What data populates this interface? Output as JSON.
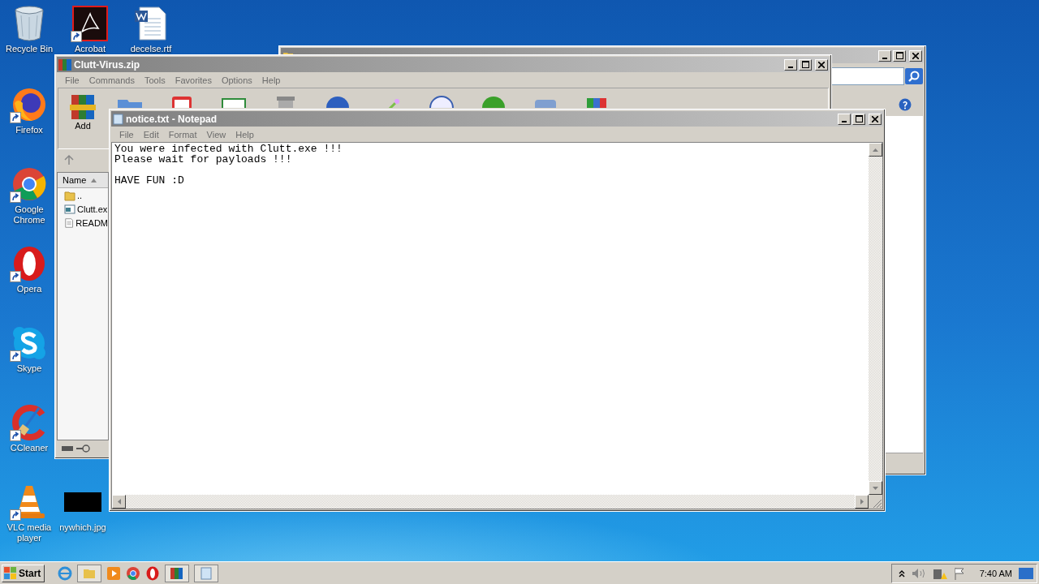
{
  "desktop_icons": [
    {
      "label": "Recycle Bin",
      "kind": "recycle",
      "shortcut": false
    },
    {
      "label": "Acrobat",
      "kind": "acrobat",
      "shortcut": true
    },
    {
      "label": "decelse.rtf",
      "kind": "word",
      "shortcut": false
    },
    {
      "label": "Firefox",
      "kind": "firefox",
      "shortcut": true
    },
    {
      "label": "Google Chrome",
      "kind": "chrome",
      "shortcut": true
    },
    {
      "label": "Opera",
      "kind": "opera",
      "shortcut": true
    },
    {
      "label": "Skype",
      "kind": "skype",
      "shortcut": true
    },
    {
      "label": "CCleaner",
      "kind": "ccleaner",
      "shortcut": true
    },
    {
      "label": "VLC media player",
      "kind": "vlc",
      "shortcut": true
    },
    {
      "label": "nywhich.jpg",
      "kind": "image",
      "shortcut": false
    }
  ],
  "archive_window": {
    "title": "Clutt-Virus.zip",
    "menu": [
      "File",
      "Commands",
      "Tools",
      "Favorites",
      "Options",
      "Help"
    ],
    "add_button": "Add",
    "column": "Name",
    "files": [
      {
        "name": "..",
        "kind": "folder"
      },
      {
        "name": "Clutt.ex",
        "kind": "program"
      },
      {
        "name": "READM",
        "kind": "text"
      }
    ]
  },
  "notepad": {
    "title": "notice.txt - Notepad",
    "menu": [
      "File",
      "Edit",
      "Format",
      "View",
      "Help"
    ],
    "text": "You were infected with Clutt.exe !!!\nPlease wait for payloads !!!\n\nHAVE FUN :D"
  },
  "taskbar": {
    "start": "Start",
    "clock": "7:40 AM"
  }
}
